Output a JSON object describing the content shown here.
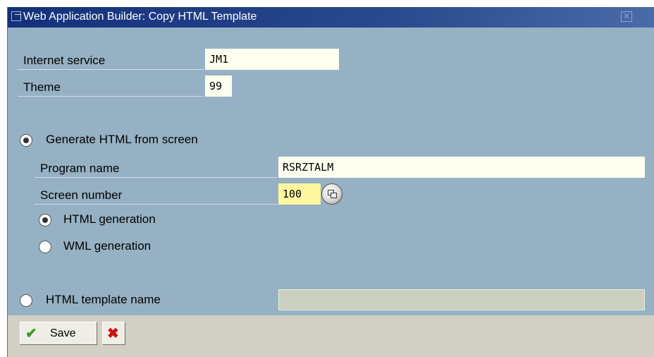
{
  "window": {
    "title": "Web Application Builder: Copy HTML Template",
    "title_icon": "window-icon",
    "close_icon": "close-icon"
  },
  "form": {
    "internet_service": {
      "label": "Internet service",
      "value": "JM1"
    },
    "theme": {
      "label": "Theme",
      "value": "99"
    },
    "generate_from_screen": {
      "label": "Generate HTML from screen",
      "selected": true
    },
    "program_name": {
      "label": "Program name",
      "value": "RSRZTALM"
    },
    "screen_number": {
      "label": "Screen number",
      "value": "100",
      "help_icon": "value-help-icon"
    },
    "html_generation": {
      "label": "HTML generation",
      "selected": true
    },
    "wml_generation": {
      "label": "WML generation",
      "selected": false
    },
    "html_template": {
      "label": "HTML template name",
      "selected": false,
      "value": ""
    }
  },
  "toolbar": {
    "save_label": "Save",
    "save_icon": "checkmark-icon",
    "cancel_icon": "cancel-icon"
  },
  "colors": {
    "title_bar": "#14307a",
    "body_bg": "#96b1c3",
    "footer_bg": "#d2d0c4",
    "input_bg": "#fffff0",
    "required_bg": "#fdf7a0",
    "save_check": "#3a9a2a",
    "cancel_x": "#cc1111"
  }
}
